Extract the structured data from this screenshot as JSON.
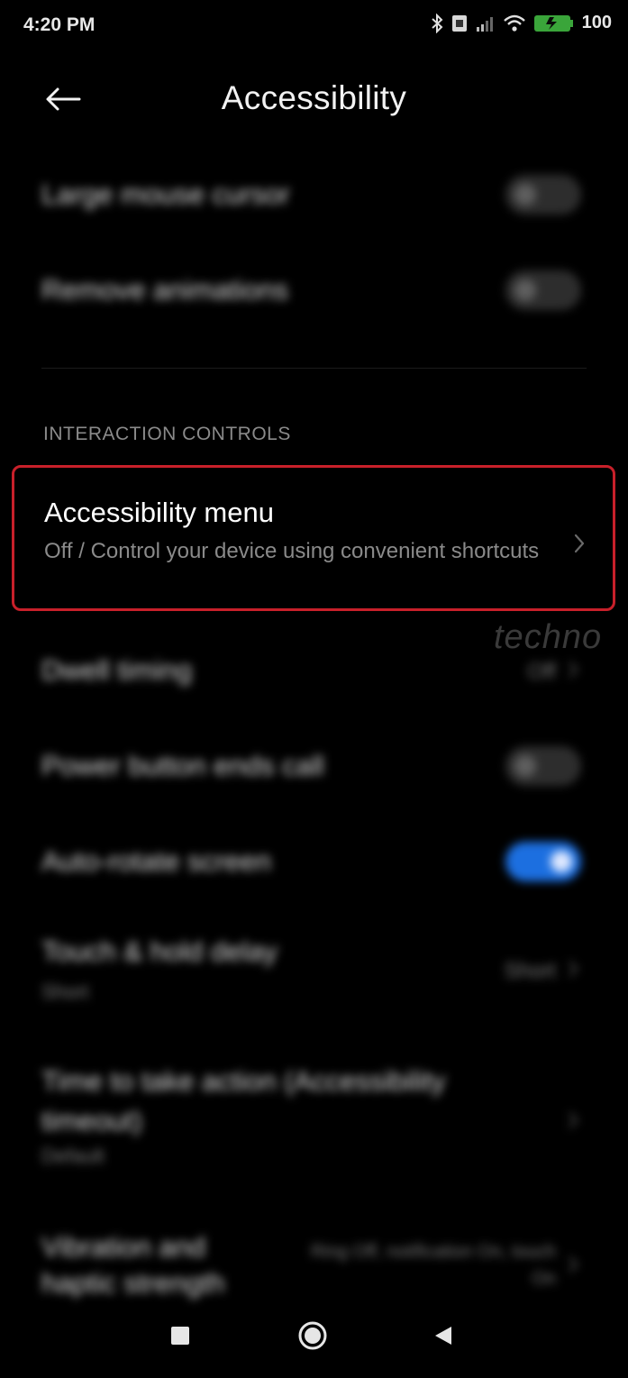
{
  "status_bar": {
    "time": "4:20 PM",
    "battery": "100",
    "icons": [
      "bluetooth-icon",
      "sim-icon",
      "signal-icon",
      "wifi-icon",
      "battery-icon"
    ]
  },
  "header": {
    "title": "Accessibility",
    "back_icon": "arrow-left-icon"
  },
  "rows_top": [
    {
      "label": "Large mouse cursor",
      "toggle": "off"
    },
    {
      "label": "Remove animations",
      "toggle": "off"
    }
  ],
  "section": {
    "header": "INTERACTION CONTROLS"
  },
  "highlighted": {
    "title": "Accessibility menu",
    "subtitle": "Off / Control your device using convenient shortcuts",
    "highlight_color": "#c8202a"
  },
  "watermark": "techno",
  "rows_bottom": [
    {
      "label": "Dwell timing",
      "value": "Off"
    },
    {
      "label": "Power button ends call",
      "toggle": "off"
    },
    {
      "label": "Auto-rotate screen",
      "toggle": "on"
    },
    {
      "label": "Touch & hold delay",
      "sub": "Short",
      "value": "Short"
    },
    {
      "label": "Time to take action (Accessibility timeout)",
      "sub": "Default"
    },
    {
      "label": "Vibration and haptic strength",
      "value": "Ring Off, notification On, touch On"
    }
  ],
  "colors": {
    "accent": "#1c6fe0",
    "background": "#000000"
  },
  "nav": {
    "icons": [
      "recents-square-icon",
      "home-circle-icon",
      "back-triangle-icon"
    ]
  }
}
